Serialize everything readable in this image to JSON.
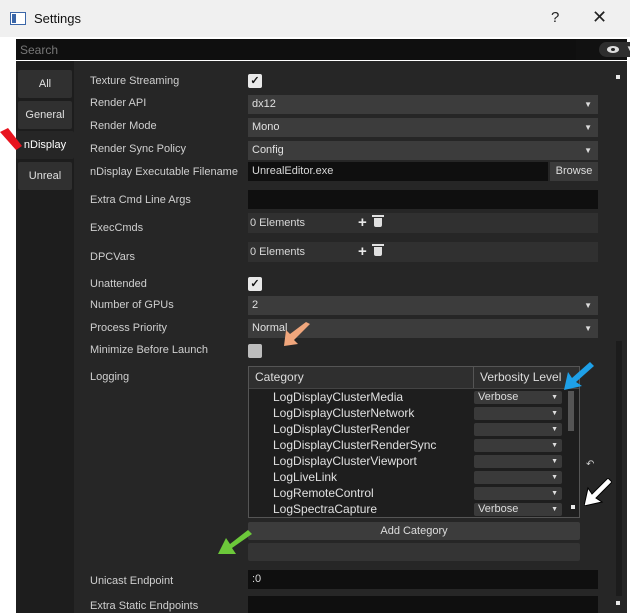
{
  "window": {
    "title": "Settings",
    "help": "?",
    "close": "✕"
  },
  "search": {
    "placeholder": "Search",
    "eye_caret": "▼"
  },
  "tabs": [
    {
      "label": "All"
    },
    {
      "label": "General"
    },
    {
      "label": "nDisplay"
    },
    {
      "label": "Unreal"
    }
  ],
  "active_tab": "nDisplay",
  "settings": {
    "texture_streaming": {
      "label": "Texture Streaming",
      "checked": true
    },
    "render_api": {
      "label": "Render API",
      "value": "dx12"
    },
    "render_mode": {
      "label": "Render Mode",
      "value": "Mono"
    },
    "render_sync_policy": {
      "label": "Render Sync Policy",
      "value": "Config"
    },
    "ndisplay_exe": {
      "label": "nDisplay Executable Filename",
      "value": "UnrealEditor.exe",
      "browse": "Browse"
    },
    "extra_cmd_line_args": {
      "label": "Extra Cmd Line Args",
      "value": ""
    },
    "exec_cmds": {
      "label": "ExecCmds",
      "value": "0 Elements"
    },
    "dpc_vars": {
      "label": "DPCVars",
      "value": "0 Elements"
    },
    "unattended": {
      "label": "Unattended",
      "checked": true
    },
    "number_of_gpus": {
      "label": "Number of GPUs",
      "value": "2"
    },
    "process_priority": {
      "label": "Process Priority",
      "value": "Normal"
    },
    "minimize_before_launch": {
      "label": "Minimize Before Launch",
      "checked": false
    },
    "logging": {
      "label": "Logging"
    },
    "unicast_endpoint": {
      "label": "Unicast Endpoint",
      "value": ":0"
    },
    "extra_static_endpoints": {
      "label": "Extra Static Endpoints",
      "value": ""
    }
  },
  "logging_table": {
    "col_category": "Category",
    "col_verbosity": "Verbosity Level",
    "rows": [
      {
        "category": "LogDisplayClusterMedia",
        "verbosity": "Verbose"
      },
      {
        "category": "LogDisplayClusterNetwork",
        "verbosity": ""
      },
      {
        "category": "LogDisplayClusterRender",
        "verbosity": ""
      },
      {
        "category": "LogDisplayClusterRenderSync",
        "verbosity": ""
      },
      {
        "category": "LogDisplayClusterViewport",
        "verbosity": ""
      },
      {
        "category": "LogLiveLink",
        "verbosity": ""
      },
      {
        "category": "LogRemoteControl",
        "verbosity": ""
      },
      {
        "category": "LogSpectraCapture",
        "verbosity": "Verbose"
      }
    ],
    "add_category": "Add Category"
  },
  "icons": {
    "caret": "▼",
    "check": "✓",
    "plus": "+",
    "reset": "↶"
  },
  "colors": {
    "red_arrow": "#e8141e",
    "orange_arrow": "#f0a67c",
    "blue_arrow": "#1ea0e8",
    "white_arrow": "#ffffff",
    "green_arrow": "#6cc83a"
  }
}
